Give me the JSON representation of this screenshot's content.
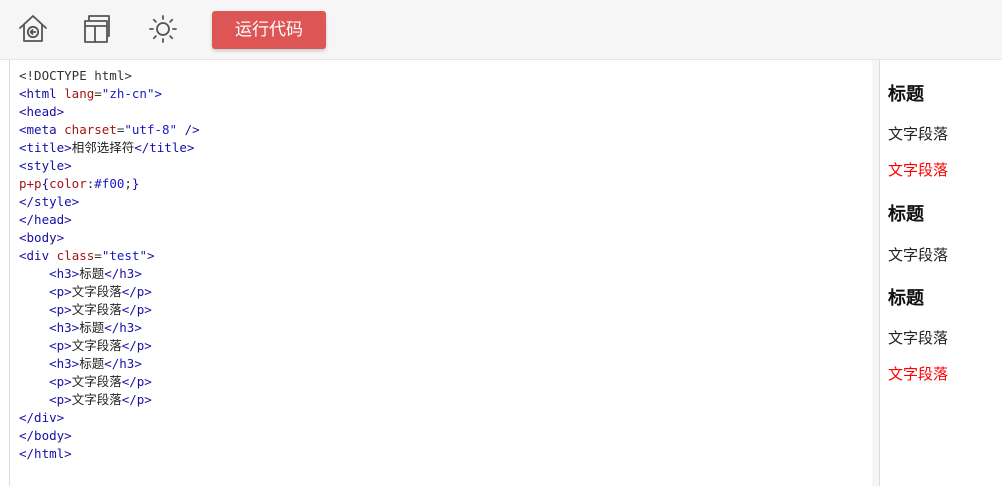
{
  "toolbar": {
    "icons": [
      {
        "name": "home-back-icon"
      },
      {
        "name": "layout-icon"
      },
      {
        "name": "brightness-icon"
      }
    ],
    "run_label": "运行代码",
    "run_color": "#dd5555"
  },
  "editor": {
    "lines": [
      [
        {
          "t": "doctype",
          "v": "<!DOCTYPE html>"
        }
      ],
      [
        {
          "t": "tag",
          "v": "<html "
        },
        {
          "t": "attr",
          "v": "lang"
        },
        {
          "t": "punc",
          "v": "="
        },
        {
          "t": "val",
          "v": "\"zh-cn\""
        },
        {
          "t": "tag",
          "v": ">"
        }
      ],
      [
        {
          "t": "tag",
          "v": "<head>"
        }
      ],
      [
        {
          "t": "tag",
          "v": "<meta "
        },
        {
          "t": "attr",
          "v": "charset"
        },
        {
          "t": "punc",
          "v": "="
        },
        {
          "t": "val",
          "v": "\"utf-8\""
        },
        {
          "t": "tag",
          "v": " />"
        }
      ],
      [
        {
          "t": "tag",
          "v": "<title>"
        },
        {
          "t": "text",
          "v": "相邻选择符"
        },
        {
          "t": "tag",
          "v": "</title>"
        }
      ],
      [
        {
          "t": "tag",
          "v": "<style>"
        }
      ],
      [
        {
          "t": "attr",
          "v": "p+p"
        },
        {
          "t": "tag",
          "v": "{"
        },
        {
          "t": "attr",
          "v": "color"
        },
        {
          "t": "punc",
          "v": ":"
        },
        {
          "t": "val",
          "v": "#f00"
        },
        {
          "t": "punc",
          "v": ";"
        },
        {
          "t": "tag",
          "v": "}"
        }
      ],
      [
        {
          "t": "tag",
          "v": "</style>"
        }
      ],
      [
        {
          "t": "tag",
          "v": "</head>"
        }
      ],
      [
        {
          "t": "tag",
          "v": "<body>"
        }
      ],
      [
        {
          "t": "tag",
          "v": "<div "
        },
        {
          "t": "attr",
          "v": "class"
        },
        {
          "t": "punc",
          "v": "="
        },
        {
          "t": "val",
          "v": "\"test\""
        },
        {
          "t": "tag",
          "v": ">"
        }
      ],
      [
        {
          "t": "text",
          "v": "    "
        },
        {
          "t": "tag",
          "v": "<h3>"
        },
        {
          "t": "text",
          "v": "标题"
        },
        {
          "t": "tag",
          "v": "</h3>"
        }
      ],
      [
        {
          "t": "text",
          "v": "    "
        },
        {
          "t": "tag",
          "v": "<p>"
        },
        {
          "t": "text",
          "v": "文字段落"
        },
        {
          "t": "tag",
          "v": "</p>"
        }
      ],
      [
        {
          "t": "text",
          "v": "    "
        },
        {
          "t": "tag",
          "v": "<p>"
        },
        {
          "t": "text",
          "v": "文字段落"
        },
        {
          "t": "tag",
          "v": "</p>"
        }
      ],
      [
        {
          "t": "text",
          "v": "    "
        },
        {
          "t": "tag",
          "v": "<h3>"
        },
        {
          "t": "text",
          "v": "标题"
        },
        {
          "t": "tag",
          "v": "</h3>"
        }
      ],
      [
        {
          "t": "text",
          "v": "    "
        },
        {
          "t": "tag",
          "v": "<p>"
        },
        {
          "t": "text",
          "v": "文字段落"
        },
        {
          "t": "tag",
          "v": "</p>"
        }
      ],
      [
        {
          "t": "text",
          "v": "    "
        },
        {
          "t": "tag",
          "v": "<h3>"
        },
        {
          "t": "text",
          "v": "标题"
        },
        {
          "t": "tag",
          "v": "</h3>"
        }
      ],
      [
        {
          "t": "text",
          "v": "    "
        },
        {
          "t": "tag",
          "v": "<p>"
        },
        {
          "t": "text",
          "v": "文字段落"
        },
        {
          "t": "tag",
          "v": "</p>"
        }
      ],
      [
        {
          "t": "text",
          "v": "    "
        },
        {
          "t": "tag",
          "v": "<p>"
        },
        {
          "t": "text",
          "v": "文字段落"
        },
        {
          "t": "tag",
          "v": "</p>"
        }
      ],
      [
        {
          "t": "tag",
          "v": "</div>"
        }
      ],
      [
        {
          "t": "tag",
          "v": "</body>"
        }
      ],
      [
        {
          "t": "tag",
          "v": "</html>"
        }
      ]
    ]
  },
  "preview": {
    "items": [
      {
        "kind": "h3",
        "text": "标题",
        "color": "#111111"
      },
      {
        "kind": "p",
        "text": "文字段落",
        "color": "#222222"
      },
      {
        "kind": "p",
        "text": "文字段落",
        "color": "#ff0000"
      },
      {
        "kind": "h3",
        "text": "标题",
        "color": "#111111"
      },
      {
        "kind": "p",
        "text": "文字段落",
        "color": "#222222"
      },
      {
        "kind": "h3",
        "text": "标题",
        "color": "#111111"
      },
      {
        "kind": "p",
        "text": "文字段落",
        "color": "#222222"
      },
      {
        "kind": "p",
        "text": "文字段落",
        "color": "#ff0000"
      }
    ]
  }
}
